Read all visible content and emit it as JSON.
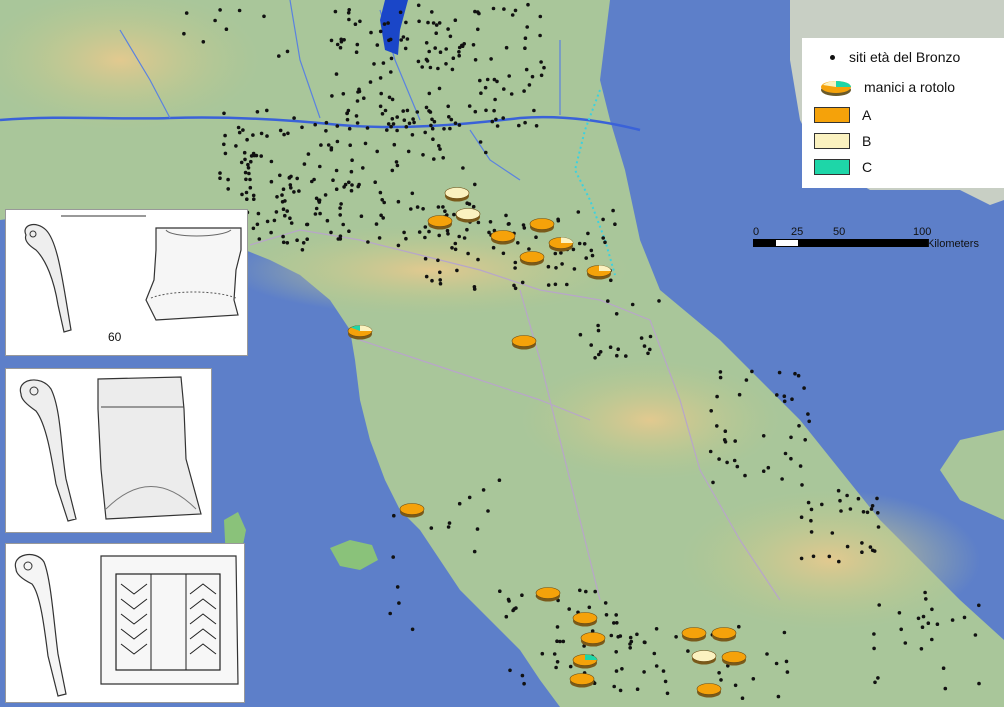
{
  "legend": {
    "sites_label": "siti età del Bronzo",
    "handles_label": "manici a rotolo",
    "classes": [
      {
        "label": "A",
        "color": "#f5a20a"
      },
      {
        "label": "B",
        "color": "#fbf2c0"
      },
      {
        "label": "C",
        "color": "#1ed6a8"
      }
    ]
  },
  "scale": {
    "ticks": [
      "0",
      "25",
      "50",
      "100"
    ],
    "unit": "Kilometers"
  },
  "panels": [
    {
      "caption": "60"
    },
    {
      "caption": ""
    },
    {
      "caption": ""
    }
  ],
  "colors": {
    "sea": "#5d7fc9",
    "land": "#a9c69a",
    "mountain": "#d8c28a",
    "site_dot": "#111111",
    "river": "#3a62d8",
    "border": "#b8a6c9"
  },
  "markers": [
    {
      "cls": "B",
      "lon_idx": 1
    },
    {
      "cls": "B",
      "lon_idx": 2
    },
    {
      "cls": "A",
      "lon_idx": 3
    },
    {
      "cls": "A",
      "lon_idx": 4
    },
    {
      "cls": "A",
      "lon_idx": 5
    },
    {
      "cls": "A",
      "lon_idx": 6
    },
    {
      "cls": "A+B",
      "lon_idx": 7
    },
    {
      "cls": "A+B",
      "lon_idx": 8
    },
    {
      "cls": "A+B+C",
      "lon_idx": 9
    },
    {
      "cls": "A",
      "lon_idx": 10
    },
    {
      "cls": "A",
      "lon_idx": 11
    },
    {
      "cls": "A",
      "lon_idx": 12
    },
    {
      "cls": "A",
      "lon_idx": 13
    },
    {
      "cls": "A+C",
      "lon_idx": 14
    },
    {
      "cls": "A",
      "lon_idx": 15
    },
    {
      "cls": "A",
      "lon_idx": 16
    },
    {
      "cls": "A",
      "lon_idx": 17
    },
    {
      "cls": "B",
      "lon_idx": 18
    },
    {
      "cls": "A",
      "lon_idx": 19
    },
    {
      "cls": "A",
      "lon_idx": 20
    },
    {
      "cls": "A",
      "lon_idx": 21
    }
  ]
}
